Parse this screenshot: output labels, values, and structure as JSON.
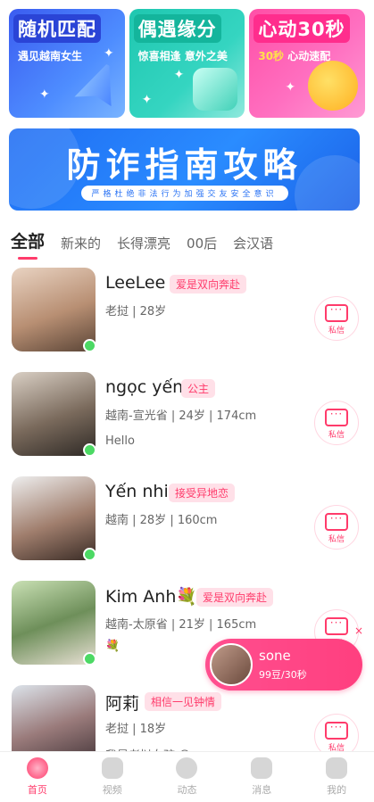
{
  "banners": [
    {
      "title": "随机匹配",
      "subtitle": "遇见越南女生"
    },
    {
      "title": "偶遇缘分",
      "subtitle": "惊喜相逢 意外之美"
    },
    {
      "title": "心动30秒",
      "subtitle_highlight": "30秒",
      "subtitle_rest": "心动速配"
    }
  ],
  "fraud_banner": {
    "title": "防诈指南攻略",
    "subtitle": "严格杜绝非法行为加强交友安全意识"
  },
  "tabs": [
    "全部",
    "新来的",
    "长得漂亮",
    "00后",
    "会汉语"
  ],
  "users": [
    {
      "name": "LeeLee",
      "tag": "爱是双向奔赴",
      "meta": "老挝 | 28岁",
      "bio": "",
      "online": true,
      "avatar_color": "#b88f73"
    },
    {
      "name": "ngọc yến",
      "tag": "公主",
      "meta": "越南-宣光省 | 24岁 | 174cm",
      "bio": "Hello",
      "online": true,
      "avatar_color": "#7a6a5c"
    },
    {
      "name": "Yến nhi",
      "tag": "接受异地恋",
      "meta": "越南 | 28岁 | 160cm",
      "bio": "",
      "online": true,
      "avatar_color": "#a07e6d"
    },
    {
      "name": "Kim Anh💐",
      "tag": "爱是双向奔赴",
      "meta": "越南-太原省 | 21岁 | 165cm",
      "bio": "💐",
      "online": true,
      "avatar_color": "#6e8f5a"
    },
    {
      "name": "阿莉",
      "tag": "相信一见钟情",
      "meta": "老挝 | 18岁",
      "bio": "我是老挝女孩 😊",
      "online": false,
      "avatar_color": "#9a7b7b"
    }
  ],
  "msg_label": "私信",
  "popup": {
    "name": "sone",
    "price": "99豆/30秒",
    "close": "×"
  },
  "bottom_nav": [
    "首页",
    "视频",
    "动态",
    "消息",
    "我的"
  ],
  "colors": {
    "accent": "#ff3b6b",
    "fraud_blue": "#1f6df3",
    "online": "#4cd964"
  }
}
